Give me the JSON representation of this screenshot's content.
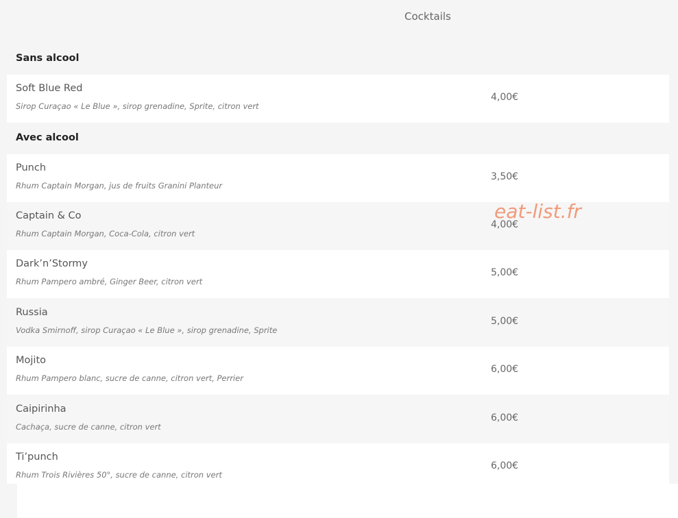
{
  "header": {
    "title": "Cocktails"
  },
  "sections": [
    {
      "title": "Sans alcool",
      "items": [
        {
          "name": "Soft Blue Red",
          "description": "Sirop Curaçao « Le Blue », sirop grenadine, Sprite, citron vert",
          "price": "4,00€"
        }
      ]
    },
    {
      "title": "Avec alcool",
      "items": [
        {
          "name": "Punch",
          "description": "Rhum Captain Morgan, jus de fruits Granini Planteur",
          "price": "3,50€"
        },
        {
          "name": "Captain & Co",
          "description": "Rhum Captain Morgan, Coca-Cola, citron vert",
          "price": "4,00€"
        },
        {
          "name": "Dark’n’Stormy",
          "description": "Rhum Pampero ambré, Ginger Beer, citron vert",
          "price": "5,00€"
        },
        {
          "name": "Russia",
          "description": "Vodka Smirnoff, sirop Curaçao « Le Blue », sirop grenadine, Sprite",
          "price": "5,00€"
        },
        {
          "name": "Mojito",
          "description": "Rhum Pampero blanc, sucre de canne, citron vert, Perrier",
          "price": "6,00€"
        },
        {
          "name": "Caipirinha",
          "description": "Cachaça, sucre de canne, citron vert",
          "price": "6,00€"
        },
        {
          "name": "Ti’punch",
          "description": "Rhum Trois Rivières 50°, sucre de canne, citron vert",
          "price": "6,00€"
        }
      ]
    }
  ],
  "watermark": "eat-list.fr"
}
